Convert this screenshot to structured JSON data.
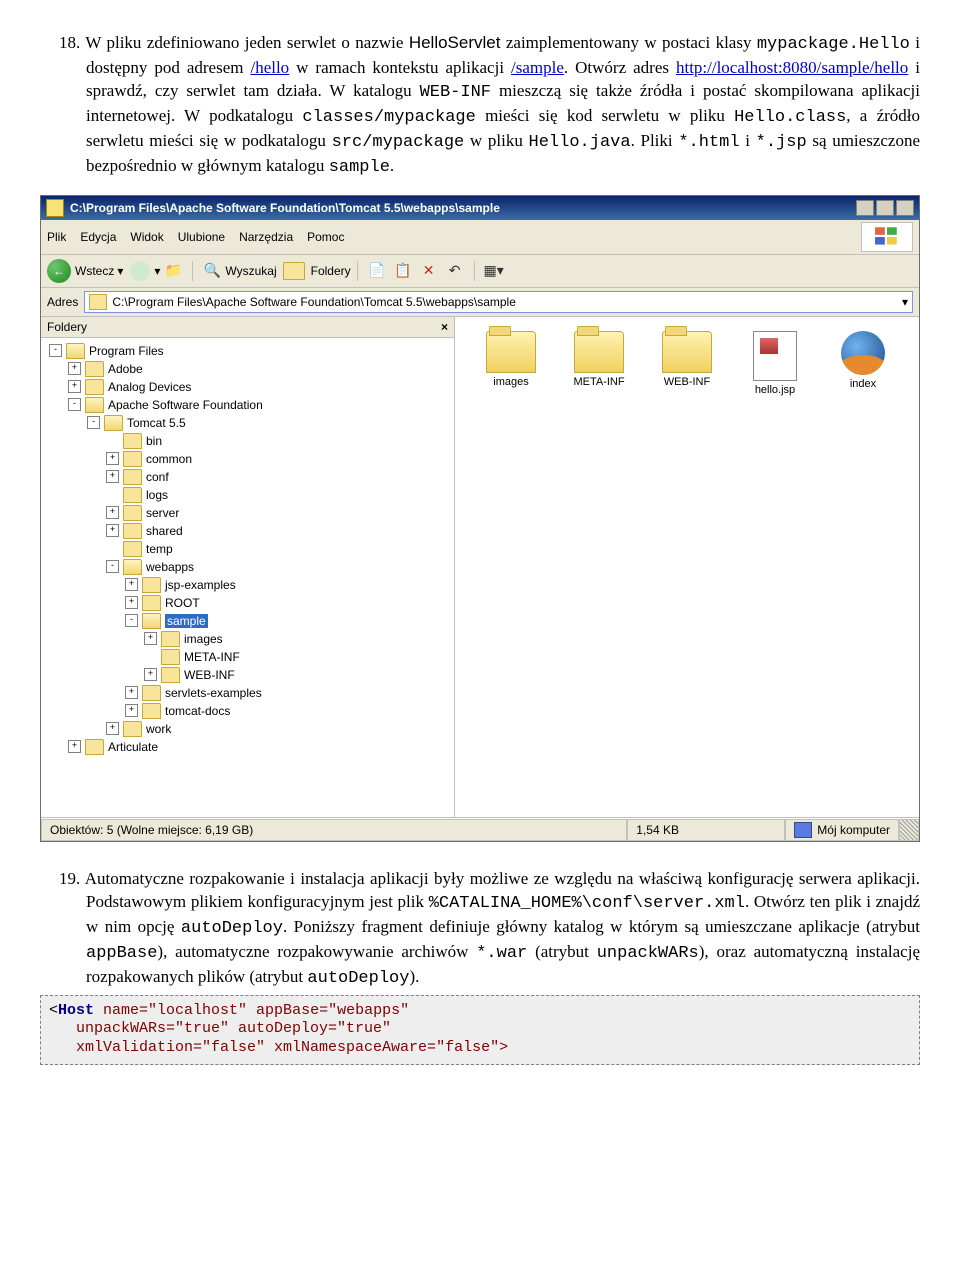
{
  "para1": {
    "num": "18. ",
    "t1": "W pliku zdefiniowano jeden serwlet o nazwie ",
    "helloServlet": "HelloServlet",
    "t2": " zaimplementowany w postaci klasy ",
    "mypackageHello": "mypackage.Hello",
    "t3": " i dostępny pod adresem ",
    "hello": "/hello",
    "t4": " w ramach kontekstu aplikacji ",
    "sample": "/sample",
    "t5": ". Otwórz adres ",
    "url": "http://localhost:8080/sample/hello",
    "t6": " i sprawdź, czy serwlet tam działa. W katalogu ",
    "webinf": "WEB-INF",
    "t7": " mieszczą się także źródła i postać skompilowana aplikacji internetowej. W podkatalogu ",
    "classesmp": "classes/mypackage",
    "t8": " mieści się kod serwletu w pliku ",
    "helloclass": "Hello.class",
    "t9": ", a źródło serwletu mieści się w podkatalogu ",
    "srcmp": "src/mypackage",
    "t10": " w pliku ",
    "hellojava": "Hello.java",
    "t11": ". Pliki ",
    "html": "*.html",
    "t12": " i ",
    "jsp": "*.jsp",
    "t13": " są umieszczone bezpośrednio w głównym katalogu ",
    "samplew": "sample",
    "t14": "."
  },
  "explorer": {
    "title": "C:\\Program Files\\Apache Software Foundation\\Tomcat 5.5\\webapps\\sample",
    "menu": [
      "Plik",
      "Edycja",
      "Widok",
      "Ulubione",
      "Narzędzia",
      "Pomoc"
    ],
    "toolbar": {
      "back": "Wstecz",
      "search": "Wyszukaj",
      "folders": "Foldery"
    },
    "address": {
      "label": "Adres",
      "value": "C:\\Program Files\\Apache Software Foundation\\Tomcat 5.5\\webapps\\sample"
    },
    "folderspane": {
      "title": "Foldery"
    },
    "tree": [
      {
        "indent": 0,
        "exp": "-",
        "open": true,
        "label": "Program Files"
      },
      {
        "indent": 1,
        "exp": "+",
        "label": "Adobe"
      },
      {
        "indent": 1,
        "exp": "+",
        "label": "Analog Devices"
      },
      {
        "indent": 1,
        "exp": "-",
        "open": true,
        "label": "Apache Software Foundation"
      },
      {
        "indent": 2,
        "exp": "-",
        "open": true,
        "label": "Tomcat 5.5"
      },
      {
        "indent": 3,
        "exp": "",
        "label": "bin"
      },
      {
        "indent": 3,
        "exp": "+",
        "label": "common"
      },
      {
        "indent": 3,
        "exp": "+",
        "label": "conf"
      },
      {
        "indent": 3,
        "exp": "",
        "label": "logs"
      },
      {
        "indent": 3,
        "exp": "+",
        "label": "server"
      },
      {
        "indent": 3,
        "exp": "+",
        "label": "shared"
      },
      {
        "indent": 3,
        "exp": "",
        "label": "temp"
      },
      {
        "indent": 3,
        "exp": "-",
        "open": true,
        "label": "webapps"
      },
      {
        "indent": 4,
        "exp": "+",
        "label": "jsp-examples"
      },
      {
        "indent": 4,
        "exp": "+",
        "label": "ROOT"
      },
      {
        "indent": 4,
        "exp": "-",
        "open": true,
        "label": "sample",
        "sel": true
      },
      {
        "indent": 5,
        "exp": "+",
        "label": "images"
      },
      {
        "indent": 5,
        "exp": "",
        "label": "META-INF"
      },
      {
        "indent": 5,
        "exp": "+",
        "label": "WEB-INF"
      },
      {
        "indent": 4,
        "exp": "+",
        "label": "servlets-examples"
      },
      {
        "indent": 4,
        "exp": "+",
        "label": "tomcat-docs"
      },
      {
        "indent": 3,
        "exp": "+",
        "label": "work"
      },
      {
        "indent": 1,
        "exp": "+",
        "label": "Articulate"
      }
    ],
    "files": [
      "images",
      "META-INF",
      "WEB-INF",
      "hello.jsp",
      "index"
    ],
    "status": {
      "objects": "Obiektów: 5 (Wolne miejsce: 6,19 GB)",
      "size": "1,54 KB",
      "location": "Mój komputer"
    }
  },
  "para2": {
    "num": "19. ",
    "t1": "Automatyczne rozpakowanie i instalacja aplikacji były możliwe ze względu na właściwą konfigurację serwera aplikacji. Podstawowym plikiem konfiguracyjnym jest plik ",
    "serverxml": "%CATALINA_HOME%\\conf\\server.xml",
    "t2": ". Otwórz ten plik i znajdź w nim opcję ",
    "autodeploy": "autoDeploy",
    "t3": ". Poniższy fragment definiuje główny katalog w którym są umieszczane aplikacje (atrybut ",
    "appbase": "appBase",
    "t4": "), automatyczne rozpakowywanie archiwów ",
    "war": "*.war",
    "t5": " (atrybut ",
    "unpack": "unpackWARs",
    "t6": "), oraz automatyczną instalację rozpakowanych plików (atrybut ",
    "autodeploy2": "autoDeploy",
    "t7": ")."
  },
  "code": {
    "l1a": "<",
    "l1b": "Host",
    "l1c": " name=\"localhost\" appBase=\"webapps\"",
    "l2": "   unpackWARs=\"true\" autoDeploy=\"true\"",
    "l3": "   xmlValidation=\"false\" xmlNamespaceAware=\"false\">"
  }
}
